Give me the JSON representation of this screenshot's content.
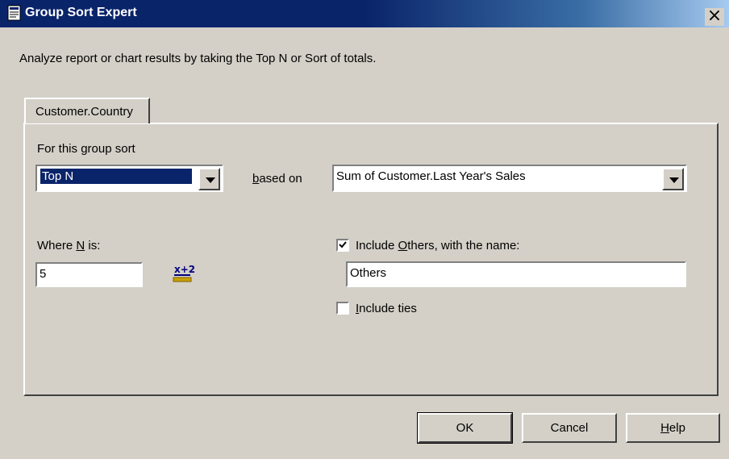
{
  "window": {
    "title": "Group Sort Expert",
    "close_label": "×",
    "description": "Analyze report or chart results by taking the Top N or Sort of totals."
  },
  "tab": {
    "label": "Customer.Country"
  },
  "group_sort": {
    "label_pre": "For this ",
    "label_ul": "g",
    "label_post": "roup sort",
    "selected": "Top N"
  },
  "based_on": {
    "label_ul": "b",
    "label_post": "ased on",
    "selected": "Sum of Customer.Last Year's Sales"
  },
  "where_n": {
    "label_pre": "Where ",
    "label_ul": "N",
    "label_post": " is:",
    "value": "5",
    "formula_icon_text": "x+2"
  },
  "include_others": {
    "checked": true,
    "label_pre": "Include ",
    "label_ul": "O",
    "label_post": "thers, with the name:",
    "name_value": "Others"
  },
  "include_ties": {
    "checked": false,
    "label_ul": "I",
    "label_post": "nclude ties"
  },
  "buttons": {
    "ok": "OK",
    "cancel": "Cancel",
    "help_ul": "H",
    "help_post": "elp"
  }
}
